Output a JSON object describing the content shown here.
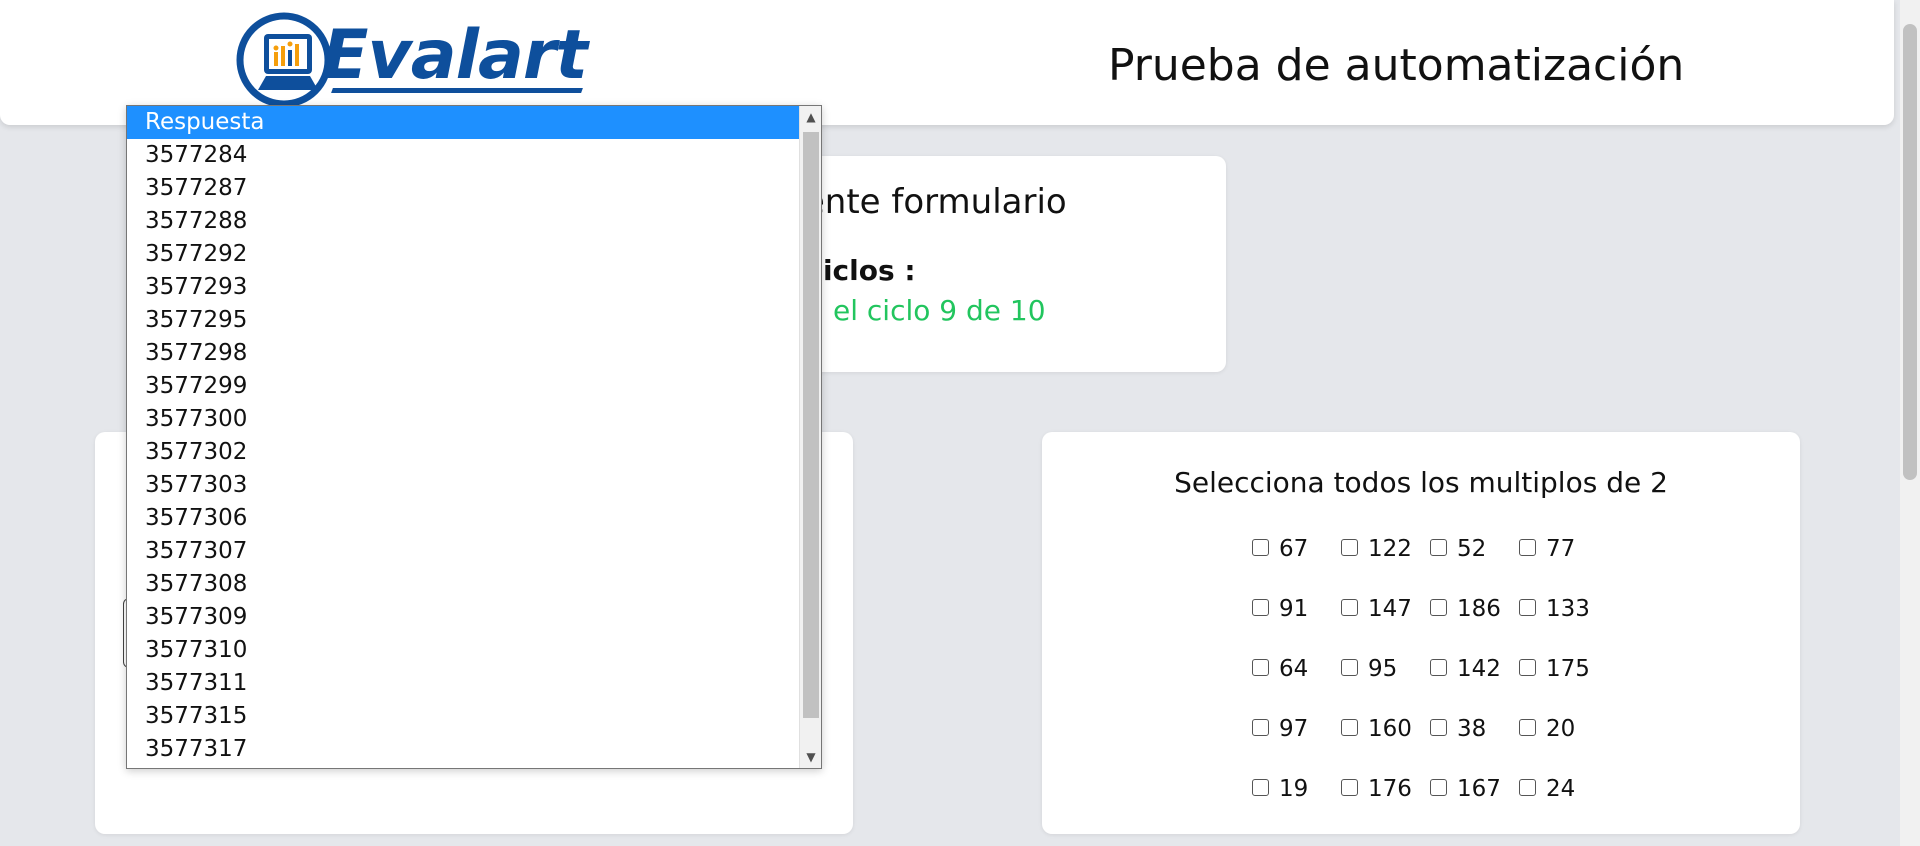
{
  "header": {
    "logo_text": "Evalart",
    "title": "Prueba de automatización"
  },
  "form_card": {
    "title": "e el siguiente formulario",
    "cycles_label": "Ciclos :",
    "cycles_status": "cuentra en el ciclo 9 de 10"
  },
  "question_card": {
    "title": "Selecciona todos los multiplos de 2",
    "options": [
      [
        "67",
        "122",
        "52",
        "77"
      ],
      [
        "91",
        "147",
        "186",
        "133"
      ],
      [
        "64",
        "95",
        "142",
        "175"
      ],
      [
        "97",
        "160",
        "38",
        "20"
      ],
      [
        "19",
        "176",
        "167",
        "24"
      ]
    ]
  },
  "dropdown": {
    "selected": "Respuesta",
    "options": [
      "Respuesta",
      "3577284",
      "3577287",
      "3577288",
      "3577292",
      "3577293",
      "3577295",
      "3577298",
      "3577299",
      "3577300",
      "3577302",
      "3577303",
      "3577306",
      "3577307",
      "3577308",
      "3577309",
      "3577310",
      "3577311",
      "3577315",
      "3577317"
    ]
  },
  "colors": {
    "brand": "#0e4f9c",
    "status_green": "#22c55e",
    "selected_option": "#1e90ff",
    "page_bg": "#e5e7eb"
  }
}
